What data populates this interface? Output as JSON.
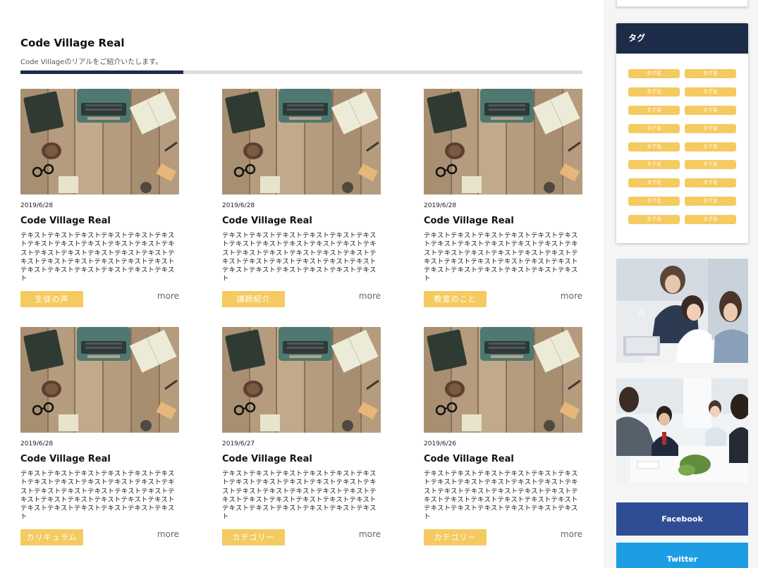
{
  "section": {
    "title": "Code Village Real",
    "subtitle": "Code Villageのリアルをご紹介いたします。",
    "progress": 0.29
  },
  "posts": [
    {
      "date": "2019/6/28",
      "title": "Code Village Real",
      "excerpt": "テキストテキストテキストテキストテキストテキストテキストテキストテキストテキストテキストテキストテキストテキストテキストテキストテキストテキストテキストテキストテキストテキストテキストテキストテキストテキストテキストテキストテキスト",
      "category": "生徒の声",
      "more": "more"
    },
    {
      "date": "2019/6/28",
      "title": "Code Village Real",
      "excerpt": "テキストテキストテキストテキストテキストテキストテキストテキストテキストテキストテキストテキストテキストテキストテキストテキストテキストテキストテキストテキストテキストテキストテキストテキストテキストテキストテキストテキストテキスト",
      "category": "講師紹介",
      "more": "more"
    },
    {
      "date": "2019/6/28",
      "title": "Code Village Real",
      "excerpt": "テキストテキストテキストテキストテキストテキストテキストテキストテキストテキストテキストテキストテキストテキストテキストテキストテキストテキストテキストテキストテキストテキストテキストテキストテキストテキストテキストテキストテキスト",
      "category": "教室のこと",
      "more": "more"
    },
    {
      "date": "2019/6/28",
      "title": "Code Village Real",
      "excerpt": "テキストテキストテキストテキストテキストテキストテキストテキストテキストテキストテキストテキストテキストテキストテキストテキストテキストテキストテキストテキストテキストテキストテキストテキストテキストテキストテキストテキストテキスト",
      "category": "カリキュラム",
      "more": "more"
    },
    {
      "date": "2019/6/27",
      "title": "Code Village Real",
      "excerpt": "テキストテキストテキストテキストテキストテキストテキストテキストテキストテキストテキストテキストテキストテキストテキストテキストテキストテキストテキストテキストテキストテキストテキストテキストテキストテキストテキストテキストテキスト",
      "category": "カテゴリー",
      "more": "more"
    },
    {
      "date": "2019/6/26",
      "title": "Code Village Real",
      "excerpt": "テキストテキストテキストテキストテキストテキストテキストテキストテキストテキストテキストテキストテキストテキストテキストテキストテキストテキストテキストテキストテキストテキストテキストテキストテキストテキストテキストテキストテキスト",
      "category": "カテゴリー",
      "more": "more"
    }
  ],
  "sidebar": {
    "tag_widget_title": "タグ",
    "tags": [
      "タグ名",
      "タグ名",
      "タグ名",
      "タグ名",
      "タグ名",
      "タグ名",
      "タグ名",
      "タグ名",
      "タグ名",
      "タグ名",
      "タグ名",
      "タグ名",
      "タグ名",
      "タグ名",
      "タグ名",
      "タグ名",
      "タグ名",
      "タグ名"
    ],
    "facebook_label": "Facebook",
    "twitter_label": "Twitter"
  },
  "colors": {
    "navy": "#1c2b47",
    "tag_yellow": "#f5ca60",
    "facebook": "#2f4d95",
    "twitter": "#1d9de4"
  },
  "icons": [
    "typewriter-desk-photo",
    "office-team-photo",
    "business-meeting-photo"
  ]
}
